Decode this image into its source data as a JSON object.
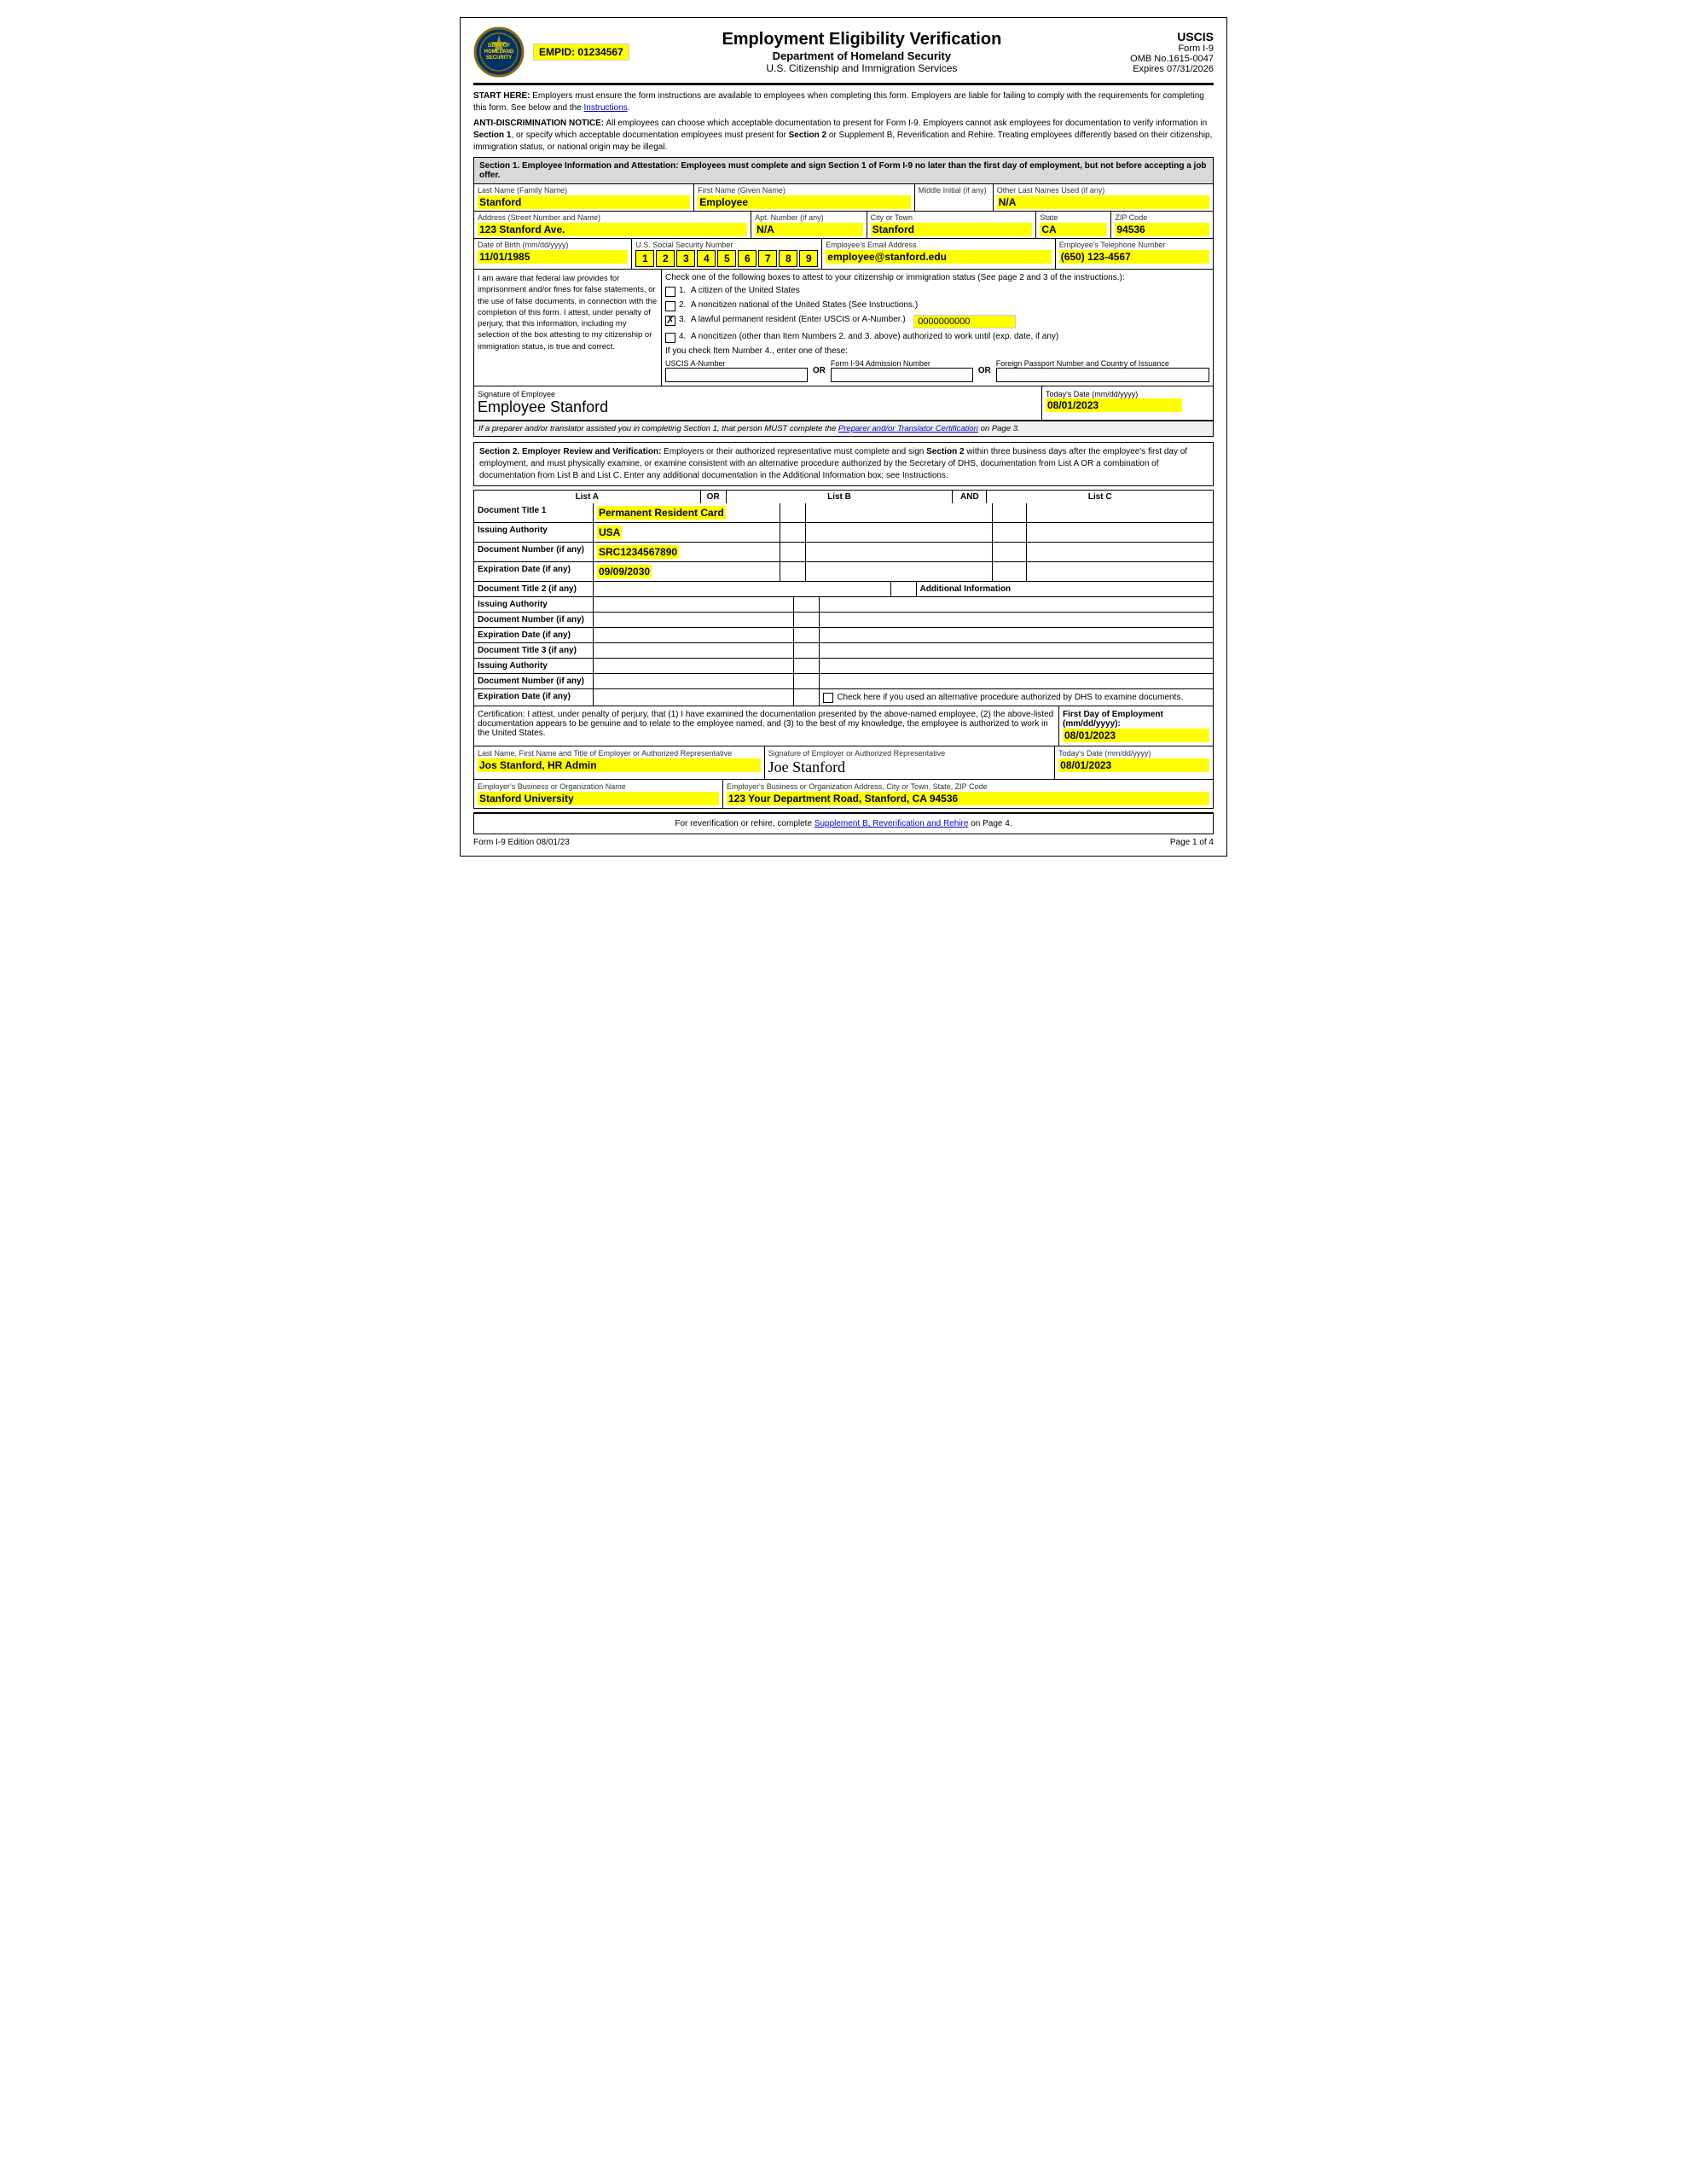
{
  "header": {
    "empid_label": "EMPID: 01234567",
    "title": "Employment Eligibility Verification",
    "subtitle": "Department of Homeland Security",
    "agency": "U.S. Citizenship and Immigration Services",
    "form_name": "USCIS",
    "form_number": "Form I-9",
    "omb": "OMB No.1615-0047",
    "expires": "Expires 07/31/2026"
  },
  "notices": {
    "start_here": "START HERE:  Employers must ensure the form instructions are available to employees when completing this form.  Employers are liable for failing to comply with the requirements for completing this form.  See below and the Instructions.",
    "anti_discrimination": "ANTI-DISCRIMINATION NOTICE:  All employees can choose which acceptable documentation to present for Form I-9.  Employers cannot ask employees for documentation to verify information in Section 1, or specify which acceptable documentation employees must present for Section 2 or Supplement B, Reverification and Rehire.  Treating employees differently based on their citizenship, immigration status, or national origin may be illegal."
  },
  "section1": {
    "title": "Section 1. Employee Information and Attestation:",
    "title_suffix": "Employees must complete and sign Section 1 of Form I-9 no later than the first day of employment, but not before accepting a job offer.",
    "fields": {
      "last_name_label": "Last Name (Family Name)",
      "last_name": "Stanford",
      "first_name_label": "First Name (Given Name)",
      "first_name": "Employee",
      "middle_initial_label": "Middle Initial (if any)",
      "middle_initial": "",
      "other_names_label": "Other Last Names Used (if any)",
      "other_names": "N/A",
      "address_label": "Address (Street Number and Name)",
      "address": "123 Stanford Ave.",
      "apt_label": "Apt. Number (if any)",
      "apt": "N/A",
      "city_label": "City or Town",
      "city": "Stanford",
      "state_label": "State",
      "state": "CA",
      "zip_label": "ZIP Code",
      "zip": "94536",
      "dob_label": "Date of Birth (mm/dd/yyyy)",
      "dob": "11/01/1985",
      "ssn_label": "U.S. Social Security Number",
      "ssn_digits": [
        "1",
        "2",
        "3",
        "4",
        "5",
        "6",
        "7",
        "8",
        "9"
      ],
      "email_label": "Employee's Email Address",
      "email": "employee@stanford.edu",
      "phone_label": "Employee's Telephone Number",
      "phone": "(650) 123-4567"
    },
    "attestation": {
      "left_text": "I am aware that federal law provides for imprisonment and/or fines for false statements, or the use of false documents, in connection with the completion of this form. I attest, under penalty of perjury, that this information, including my selection of the box attesting to my citizenship or immigration status, is true and correct.",
      "right_intro": "Check one of the following boxes to attest to your citizenship or immigration status (See page 2 and 3 of the instructions.):",
      "options": [
        {
          "num": "1.",
          "text": "A citizen of the United States",
          "checked": false
        },
        {
          "num": "2.",
          "text": "A noncitizen national of the United States (See Instructions.)",
          "checked": false
        },
        {
          "num": "3.",
          "text": "A lawful permanent resident (Enter USCIS or A-Number.)",
          "checked": true
        },
        {
          "num": "4.",
          "text": "A noncitizen (other than Item Numbers 2. and 3. above) authorized to work until (exp. date, if any)",
          "checked": false
        }
      ],
      "uscis_number": "0000000000",
      "item4_label": "If you check Item Number 4., enter one of these:",
      "uscis_a_label": "USCIS A-Number",
      "or1": "OR",
      "i94_label": "Form I-94 Admission Number",
      "or2": "OR",
      "passport_label": "Foreign Passport Number and Country of Issuance"
    },
    "signature": {
      "label": "Signature of Employee",
      "value": "Employee Stanford",
      "date_label": "Today's Date (mm/dd/yyyy)",
      "date": "08/01/2023"
    },
    "preparer_notice": "If a preparer and/or translator assisted you in completing Section 1, that person MUST complete the Preparer and/or Translator Certification on Page 3."
  },
  "section2": {
    "title": "Section 2. Employer Review and Verification:",
    "description": "Employers or their authorized representative must complete and sign Section 2 within three business days after the employee's first day of employment, and must physically examine, or examine consistent with an alternative procedure authorized by the Secretary of DHS, documentation from List A OR a combination of documentation from List B and List C.  Enter any additional documentation in the Additional Information box; see Instructions.",
    "col_headers": {
      "list_a": "List A",
      "or": "OR",
      "list_b": "List B",
      "and": "AND",
      "list_c": "List C"
    },
    "doc1": {
      "label": "Document Title 1",
      "list_a": "Permanent Resident Card",
      "list_b": "",
      "list_c": ""
    },
    "issuing1": {
      "label": "Issuing Authority",
      "list_a": "USA",
      "list_b": "",
      "list_c": ""
    },
    "docnum1": {
      "label": "Document Number (if any)",
      "list_a": "SRC1234567890",
      "list_b": "",
      "list_c": ""
    },
    "expdate1": {
      "label": "Expiration Date (if any)",
      "list_a": "09/09/2030",
      "list_b": "",
      "list_c": ""
    },
    "doc2": {
      "label": "Document Title 2 (if any)",
      "list_a": "",
      "additional_info_label": "Additional Information"
    },
    "issuing2": {
      "label": "Issuing Authority",
      "list_a": ""
    },
    "docnum2": {
      "label": "Document Number (if any)",
      "list_a": ""
    },
    "expdate2": {
      "label": "Expiration Date (if any)",
      "list_a": ""
    },
    "doc3": {
      "label": "Document Title 3 (if any)",
      "list_a": ""
    },
    "issuing3": {
      "label": "Issuing Authority",
      "list_a": ""
    },
    "docnum3": {
      "label": "Document Number (if any)",
      "list_a": ""
    },
    "expdate3": {
      "label": "Expiration Date (if any)",
      "list_a": ""
    },
    "alt_procedure_label": "Check here if you used an alternative procedure authorized by DHS to examine documents.",
    "certification": {
      "text": "Certification: I attest, under penalty of perjury, that (1) I have examined the documentation presented by the above-named employee, (2) the above-listed documentation appears to be genuine and to relate to the employee named, and (3) to the best of my knowledge, the employee is authorized to work in the United States.",
      "first_day_label": "First Day of Employment (mm/dd/yyyy):",
      "first_day": "08/01/2023"
    },
    "employer": {
      "name_label": "Last Name, First Name and Title of Employer or Authorized Representative",
      "name": "Jos Stanford, HR Admin",
      "sig_label": "Signature of Employer or Authorized Representative",
      "sig_value": "Joe Stanford",
      "date_label": "Today's Date (mm/dd/yyyy)",
      "date": "08/01/2023",
      "org_label": "Employer's Business or Organization Name",
      "org": "Stanford University",
      "address_label": "Employer's Business or Organization Address, City or Town, State, ZIP Code",
      "address": "123 Your Department Road, Stanford, CA 94536"
    }
  },
  "footer": {
    "reverification": "For reverification or rehire, complete Supplement B, Reverification and Rehire on Page 4.",
    "supplement_b_link": "Supplement B, Reverification and Rehire",
    "edition": "Form I-9  Edition  08/01/23",
    "page": "Page 1 of 4"
  }
}
